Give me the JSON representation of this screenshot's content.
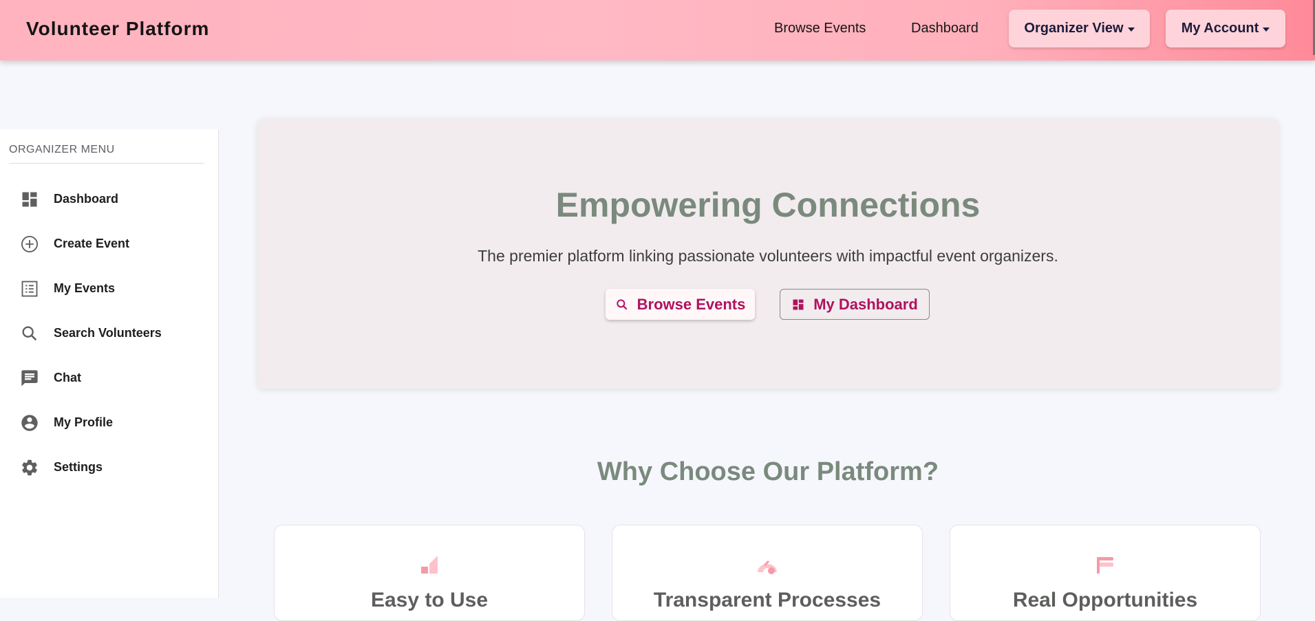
{
  "header": {
    "brand": "Volunteer Platform",
    "nav_browse": "Browse Events",
    "nav_dashboard": "Dashboard",
    "organizer_view": "Organizer View",
    "my_account": "My Account"
  },
  "sidebar": {
    "heading": "ORGANIZER MENU",
    "items": [
      {
        "label": "Dashboard",
        "icon": "dashboard-icon"
      },
      {
        "label": "Create Event",
        "icon": "add-circle-icon"
      },
      {
        "label": "My Events",
        "icon": "list-icon"
      },
      {
        "label": "Search Volunteers",
        "icon": "search-icon"
      },
      {
        "label": "Chat",
        "icon": "chat-icon"
      },
      {
        "label": "My Profile",
        "icon": "account-circle-icon"
      },
      {
        "label": "Settings",
        "icon": "gear-icon"
      }
    ]
  },
  "hero": {
    "title": "Empowering Connections",
    "subtitle": "The premier platform linking passionate volunteers with impactful event organizers.",
    "browse_label": "Browse Events",
    "dashboard_label": "My Dashboard"
  },
  "why": {
    "title": "Why Choose Our Platform?",
    "cards": [
      {
        "title": "Easy to Use",
        "icon": "signal-bars-icon"
      },
      {
        "title": "Transparent Processes",
        "icon": "gauge-icon"
      },
      {
        "title": "Real Opportunities",
        "icon": "flag-icon"
      }
    ]
  },
  "colors": {
    "accent": "#b0125e",
    "heading": "#7a8a7d",
    "topbar": "#ffb3bf",
    "icon_pink": "#f59aa8"
  }
}
